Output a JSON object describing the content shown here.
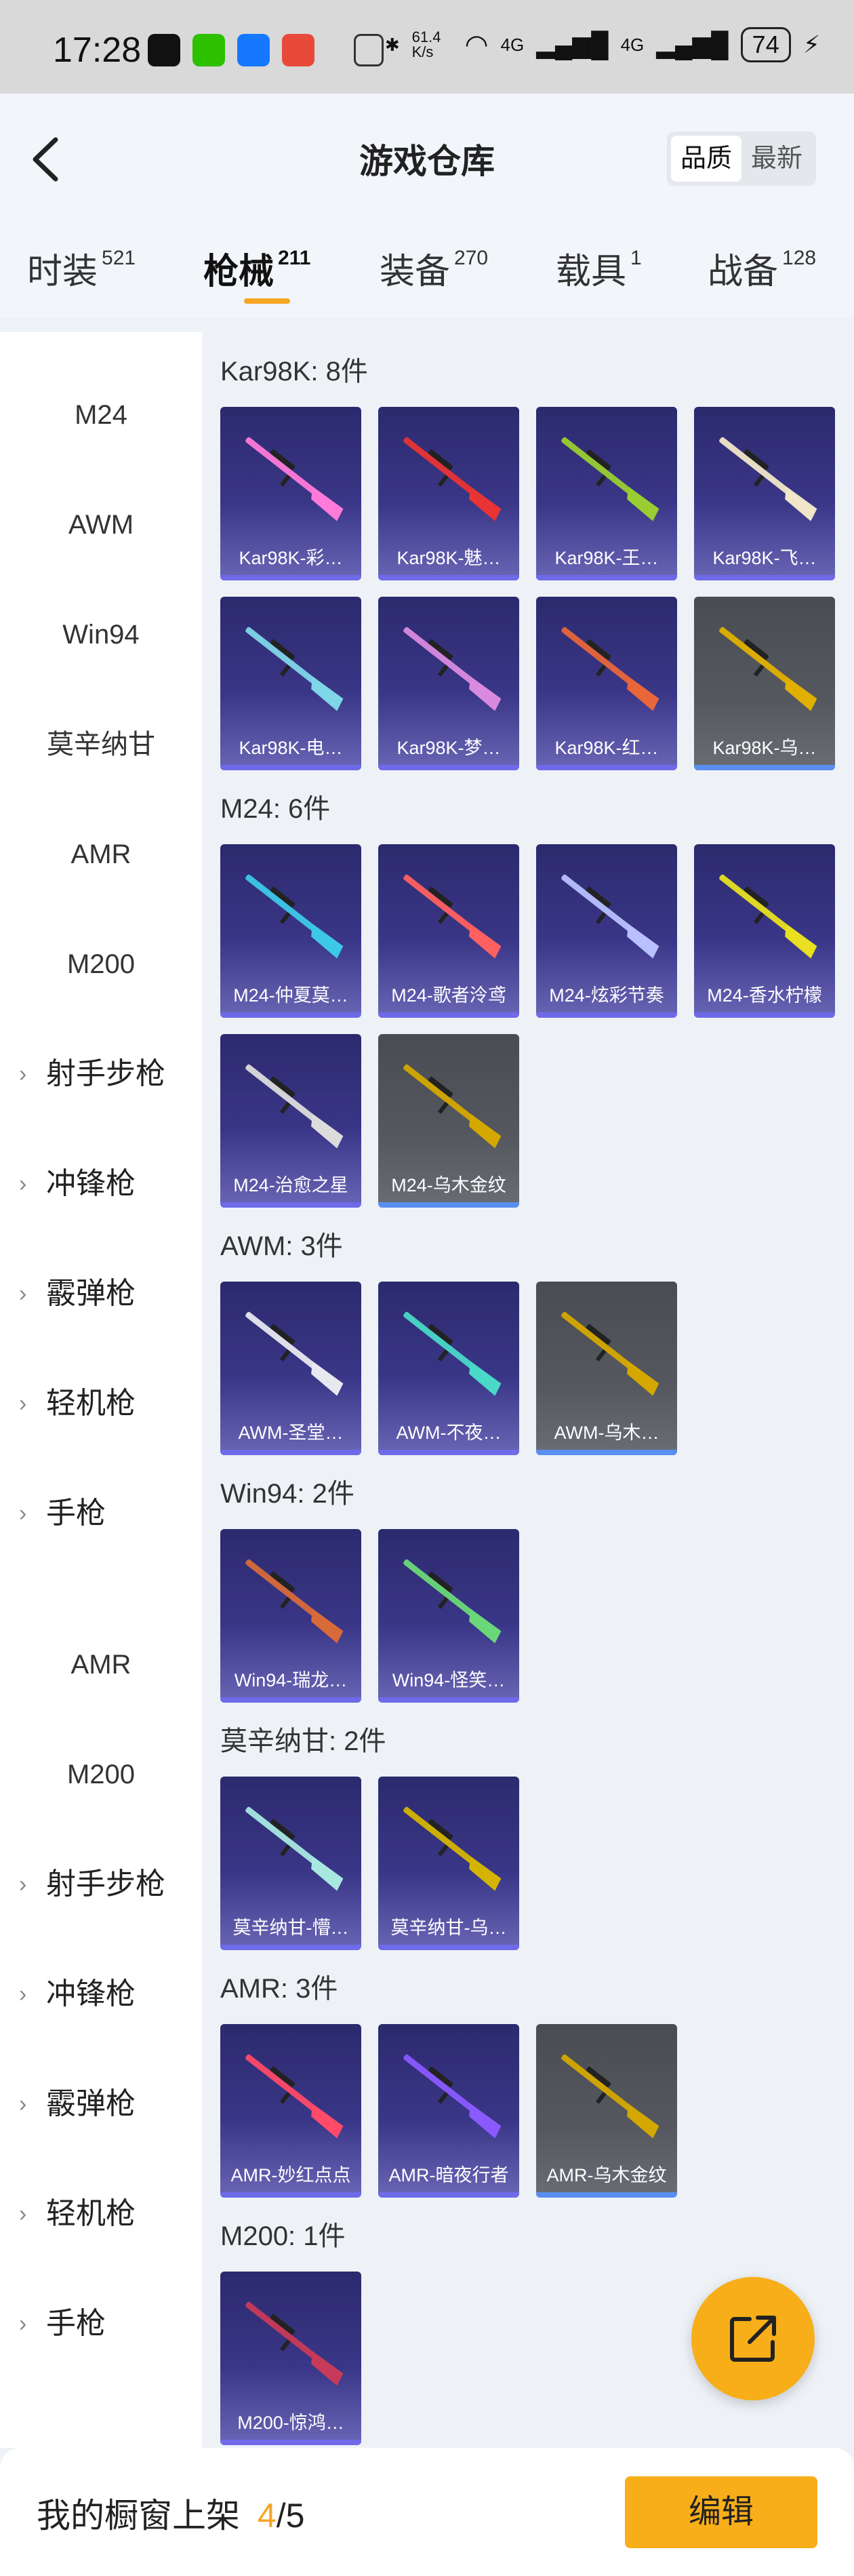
{
  "status_bar": {
    "time": "17:28",
    "net_speed": "61.4 K/s",
    "battery": "74",
    "signal_1": "4G",
    "signal_2": "4G"
  },
  "header": {
    "title": "游戏仓库",
    "sort_options": [
      "品质",
      "最新"
    ],
    "active_sort": "品质"
  },
  "tabs": [
    {
      "label": "时装",
      "count": "521"
    },
    {
      "label": "枪械",
      "count": "211",
      "active": true
    },
    {
      "label": "装备",
      "count": "270"
    },
    {
      "label": "载具",
      "count": "1"
    },
    {
      "label": "战备",
      "count": "128"
    }
  ],
  "sidebar": [
    {
      "label": "M24",
      "group": false
    },
    {
      "label": "AWM",
      "group": false
    },
    {
      "label": "Win94",
      "group": false
    },
    {
      "label": "莫辛纳甘",
      "group": false
    },
    {
      "label": "AMR",
      "group": false
    },
    {
      "label": "M200",
      "group": false
    },
    {
      "label": "射手步枪",
      "group": true
    },
    {
      "label": "冲锋枪",
      "group": true
    },
    {
      "label": "霰弹枪",
      "group": true
    },
    {
      "label": "轻机枪",
      "group": true
    },
    {
      "label": "手枪",
      "group": true
    },
    {
      "label": "AMR",
      "group": false
    },
    {
      "label": "M200",
      "group": false
    },
    {
      "label": "射手步枪",
      "group": true
    },
    {
      "label": "冲锋枪",
      "group": true
    },
    {
      "label": "霰弹枪",
      "group": true
    },
    {
      "label": "轻机枪",
      "group": true
    },
    {
      "label": "手枪",
      "group": true
    }
  ],
  "sections": [
    {
      "title": "Kar98K: 8件",
      "items": [
        {
          "name": "Kar98K-彩…",
          "tier": "purple",
          "color": "#ff7ad9"
        },
        {
          "name": "Kar98K-魅…",
          "tier": "purple",
          "color": "#e83434"
        },
        {
          "name": "Kar98K-王…",
          "tier": "purple",
          "color": "#9acd32"
        },
        {
          "name": "Kar98K-飞…",
          "tier": "purple",
          "color": "#f0e6c8"
        },
        {
          "name": "Kar98K-电…",
          "tier": "purple",
          "color": "#7fd6e8"
        },
        {
          "name": "Kar98K-梦…",
          "tier": "purple",
          "color": "#d98ae0"
        },
        {
          "name": "Kar98K-红…",
          "tier": "purple",
          "color": "#e8663a"
        },
        {
          "name": "Kar98K-乌…",
          "tier": "gray",
          "color": "#e0b000"
        }
      ]
    },
    {
      "title": "M24: 6件",
      "items": [
        {
          "name": "M24-仲夏莫…",
          "tier": "purple",
          "color": "#3ec8e8"
        },
        {
          "name": "M24-歌者泠鸢",
          "tier": "purple",
          "color": "#ff6060"
        },
        {
          "name": "M24-炫彩节奏",
          "tier": "purple",
          "color": "#b8c0ff"
        },
        {
          "name": "M24-香水柠檬",
          "tier": "purple",
          "color": "#e8e020"
        },
        {
          "name": "M24-治愈之星",
          "tier": "purple",
          "color": "#dcdcdc"
        },
        {
          "name": "M24-乌木金纹",
          "tier": "gray",
          "color": "#d4a800"
        }
      ]
    },
    {
      "title": "AWM: 3件",
      "items": [
        {
          "name": "AWM-圣堂…",
          "tier": "purple",
          "color": "#e8e8f0"
        },
        {
          "name": "AWM-不夜…",
          "tier": "purple",
          "color": "#4ad8c8"
        },
        {
          "name": "AWM-乌木…",
          "tier": "gray",
          "color": "#d4a800"
        }
      ]
    },
    {
      "title": "Win94: 2件",
      "items": [
        {
          "name": "Win94-瑞龙…",
          "tier": "purple",
          "color": "#d86a3a"
        },
        {
          "name": "Win94-怪笑…",
          "tier": "purple",
          "color": "#6ad878"
        }
      ]
    },
    {
      "title": "莫辛纳甘: 2件",
      "items": [
        {
          "name": "莫辛纳甘-懵…",
          "tier": "purple",
          "color": "#a8e8e0"
        },
        {
          "name": "莫辛纳甘-乌…",
          "tier": "purple",
          "color": "#d4b400"
        }
      ]
    },
    {
      "title": "AMR: 3件",
      "items": [
        {
          "name": "AMR-妙红点点",
          "tier": "purple",
          "color": "#ff4a6a"
        },
        {
          "name": "AMR-暗夜行者",
          "tier": "purple",
          "color": "#8a5aff"
        },
        {
          "name": "AMR-乌木金纹",
          "tier": "gray",
          "color": "#d4a800"
        }
      ]
    },
    {
      "title": "M200: 1件",
      "items": [
        {
          "name": "M200-惊鸿…",
          "tier": "purple",
          "color": "#c83a5a"
        }
      ]
    }
  ],
  "bottom_bar": {
    "label": "我的橱窗上架",
    "shown": "4",
    "total": "/5",
    "edit_label": "编辑"
  },
  "colors": {
    "accent": "#f7ae18",
    "card_purple": "#3a3687",
    "card_gray": "#55585f"
  }
}
